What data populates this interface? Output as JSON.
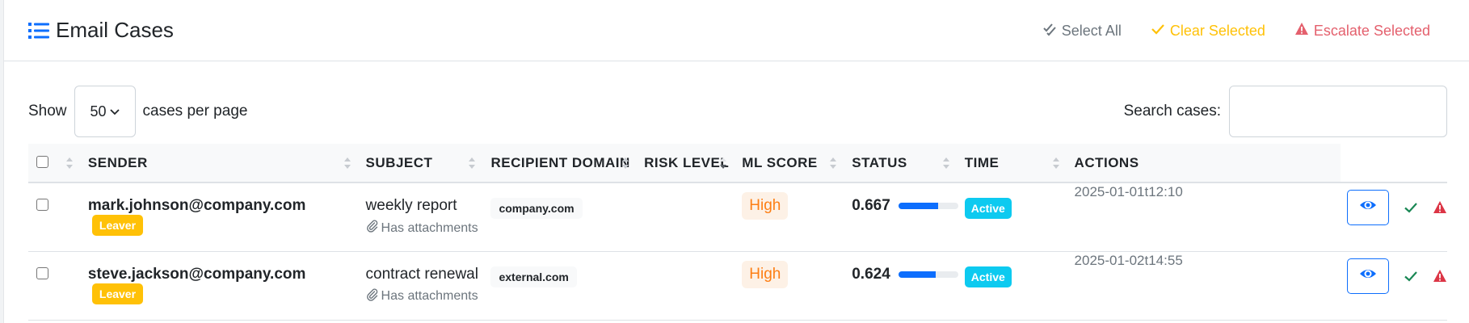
{
  "header": {
    "title": "Email Cases",
    "select_all": "Select All",
    "clear_selected": "Clear Selected",
    "escalate_selected": "Escalate Selected"
  },
  "controls": {
    "show_label": "Show",
    "per_page_value": "50",
    "per_page_suffix": "cases per page",
    "search_label": "Search cases:",
    "search_value": ""
  },
  "table": {
    "columns": [
      "SENDER",
      "SUBJECT",
      "RECIPIENT DOMAIN",
      "RISK LEVEL",
      "ML SCORE",
      "STATUS",
      "TIME",
      "ACTIONS"
    ],
    "rows": [
      {
        "sender": "mark.johnson@company.com",
        "sender_badge": "Leaver",
        "subject": "weekly report",
        "attachments": "Has attachments",
        "domain": "company.com",
        "risk": "High",
        "ml_score": "0.667",
        "ml_fraction": 0.667,
        "status": "Active",
        "time": "2025-01-01t12:10"
      },
      {
        "sender": "steve.jackson@company.com",
        "sender_badge": "Leaver",
        "subject": "contract renewal",
        "attachments": "Has attachments",
        "domain": "external.com",
        "risk": "High",
        "ml_score": "0.624",
        "ml_fraction": 0.624,
        "status": "Active",
        "time": "2025-01-02t14:55"
      }
    ]
  },
  "colors": {
    "primary": "#0d6efd",
    "warning": "#ffc107",
    "danger": "#e4606d",
    "info": "#0dcaf0",
    "risk_high": "#fd7e14",
    "success": "#198754"
  },
  "icons": [
    "list-icon",
    "check-double-icon",
    "check-icon",
    "warning-triangle-icon",
    "chevron-down-icon",
    "sort-icon",
    "paperclip-icon",
    "eye-icon"
  ]
}
